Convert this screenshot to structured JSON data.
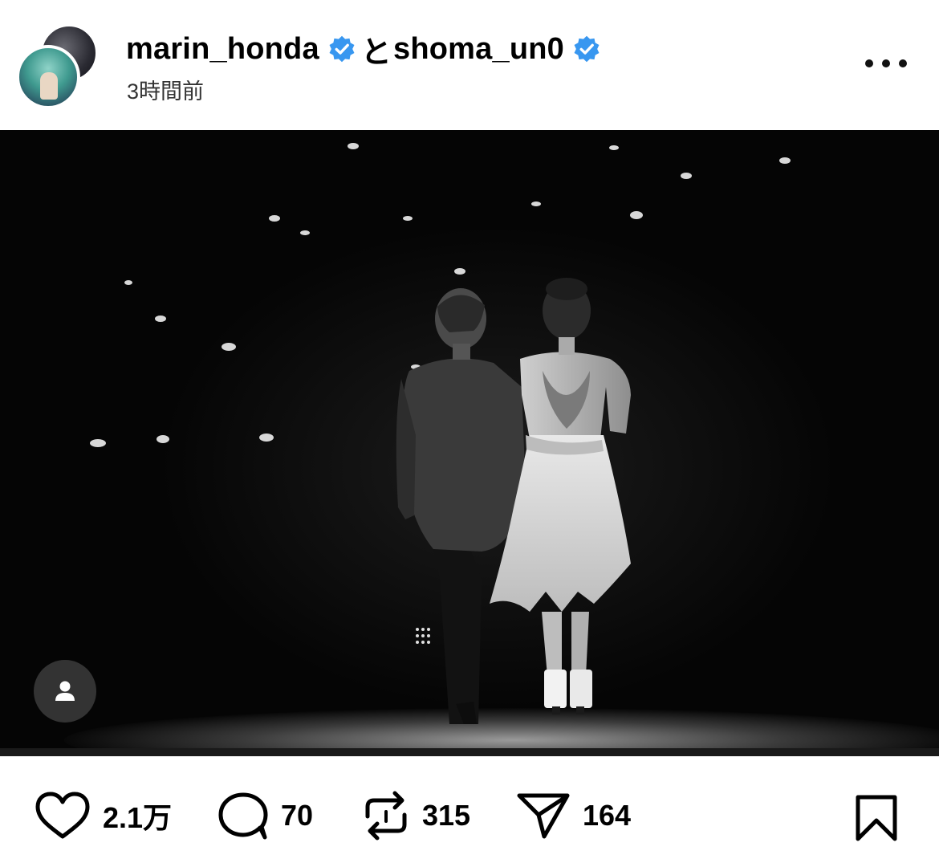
{
  "post": {
    "author_1": "marin_honda",
    "conjunction": "と",
    "author_2": "shoma_un0",
    "timestamp": "3時間前"
  },
  "colors": {
    "verified": "#3897f0",
    "text": "#000000",
    "photo_bg": "#050505"
  },
  "icons": {
    "verified": "verified-badge-icon",
    "more": "more-options-icon",
    "user_tag": "user-tag-icon",
    "like": "heart-icon",
    "comment": "comment-bubble-icon",
    "repost": "repost-icon",
    "share": "send-icon",
    "save": "bookmark-icon"
  },
  "actions": {
    "likes": "2.1万",
    "comments": "70",
    "reposts": "315",
    "shares": "164"
  }
}
